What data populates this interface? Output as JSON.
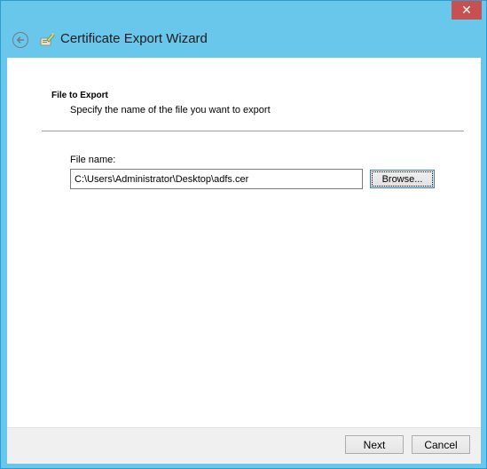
{
  "window": {
    "title": "Certificate Export Wizard",
    "close_glyph": "✕"
  },
  "icons": {
    "back": "back-arrow-icon",
    "wizard": "certificate-wizard-icon",
    "close": "close-icon"
  },
  "page": {
    "section_title": "File to Export",
    "section_description": "Specify the name of the file you want to export",
    "file_name_label": "File name:",
    "file_name_value": "C:\\Users\\Administrator\\Desktop\\adfs.cer",
    "browse_label": "Browse..."
  },
  "footer": {
    "next_label": "Next",
    "cancel_label": "Cancel"
  },
  "colors": {
    "frame": "#69c7ec",
    "close_button": "#c75050",
    "content_bg": "#ffffff",
    "footer_bg": "#f0f0f0"
  }
}
